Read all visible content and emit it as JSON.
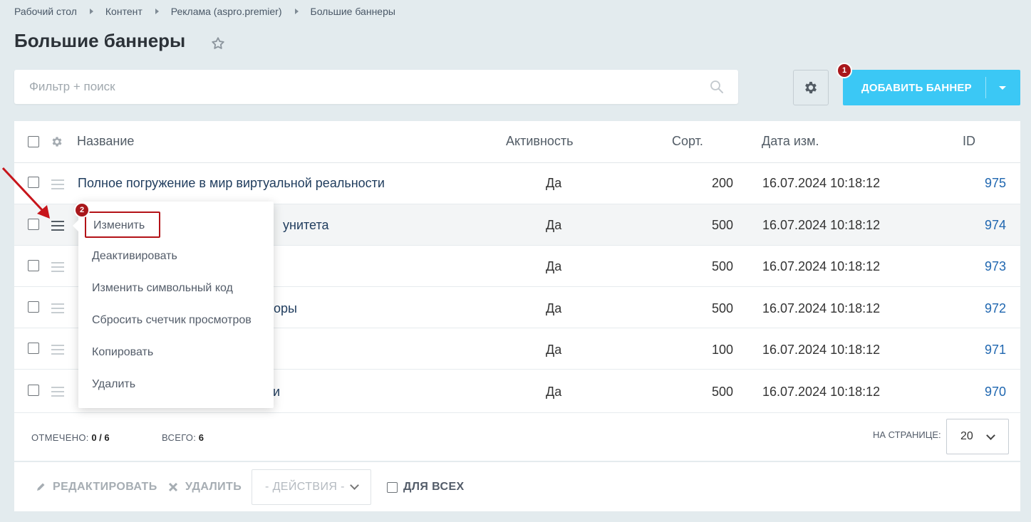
{
  "breadcrumb": [
    "Рабочий стол",
    "Контент",
    "Реклама (aspro.premier)",
    "Большие баннеры"
  ],
  "page_title": "Большие баннеры",
  "search": {
    "placeholder": "Фильтр + поиск"
  },
  "toolbar": {
    "add_label": "ДОБАВИТЬ БАННЕР",
    "badge_1": "1",
    "badge_2": "2"
  },
  "colors": {
    "accent": "#3bc8f5",
    "badge": "#a9171b",
    "link": "#2067b0",
    "background": "#e3ebee"
  },
  "table": {
    "headers": {
      "name": "Название",
      "active": "Активность",
      "sort": "Сорт.",
      "date": "Дата изм.",
      "id": "ID"
    },
    "rows": [
      {
        "name": "Полное погружение в мир виртуальной реальности",
        "active": "Да",
        "sort": "200",
        "date": "16.07.2024 10:18:12",
        "id": "975"
      },
      {
        "name": "унитета",
        "active": "Да",
        "sort": "500",
        "date": "16.07.2024 10:18:12",
        "id": "974"
      },
      {
        "name": "",
        "active": "Да",
        "sort": "500",
        "date": "16.07.2024 10:18:12",
        "id": "973"
      },
      {
        "name": "оры",
        "active": "Да",
        "sort": "500",
        "date": "16.07.2024 10:18:12",
        "id": "972"
      },
      {
        "name": "",
        "active": "Да",
        "sort": "100",
        "date": "16.07.2024 10:18:12",
        "id": "971"
      },
      {
        "name": "и",
        "active": "Да",
        "sort": "500",
        "date": "16.07.2024 10:18:12",
        "id": "970"
      }
    ]
  },
  "footer": {
    "checked_label": "ОТМЕЧЕНО:",
    "checked_value": "0 / 6",
    "total_label": "ВСЕГО:",
    "total_value": "6",
    "per_page_label": "НА СТРАНИЦЕ:",
    "per_page_value": "20"
  },
  "actions": {
    "edit": "РЕДАКТИРОВАТЬ",
    "delete": "УДАЛИТЬ",
    "select": "- ДЕЙСТВИЯ -",
    "for_all": "ДЛЯ ВСЕХ"
  },
  "context_menu": {
    "items": [
      "Изменить",
      "Деактивировать",
      "Изменить символьный код",
      "Сбросить счетчик просмотров",
      "Копировать",
      "Удалить"
    ]
  }
}
